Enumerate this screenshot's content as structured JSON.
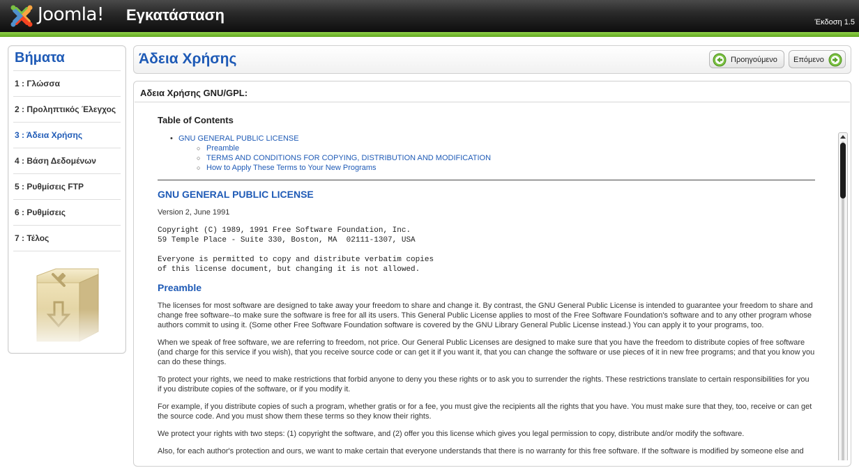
{
  "header": {
    "logo_text": "Joomla!",
    "title": "Εγκατάσταση",
    "version": "Έκδοση 1.5"
  },
  "sidebar": {
    "title": "Βήματα",
    "items": [
      {
        "label": "1 : Γλώσσα"
      },
      {
        "label": "2 : Προληπτικός Έλεγχος"
      },
      {
        "label": "3 : Άδεια Χρήσης",
        "active": true
      },
      {
        "label": "4 : Βάση Δεδομένων"
      },
      {
        "label": "5 : Ρυθμίσεις FTP"
      },
      {
        "label": "6 : Ρυθμίσεις"
      },
      {
        "label": "7 : Τέλος"
      }
    ],
    "icon": "install-box-icon"
  },
  "titlebar": {
    "title": "Άδεια Χρήσης",
    "prev_label": "Προηγούμενο",
    "next_label": "Επόμενο"
  },
  "license": {
    "heading": "Αδεια Χρήσης GNU/GPL:",
    "toc_title": "Table of Contents",
    "toc": [
      "GNU GENERAL PUBLIC LICENSE",
      "Preamble",
      "TERMS AND CONDITIONS FOR COPYING, DISTRIBUTION AND MODIFICATION",
      "How to Apply These Terms to Your New Programs"
    ],
    "gpl_title": "GNU GENERAL PUBLIC LICENSE",
    "version_line": "Version 2, June 1991",
    "copyright": "Copyright (C) 1989, 1991 Free Software Foundation, Inc.\n59 Temple Place - Suite 330, Boston, MA  02111-1307, USA",
    "permission": "Everyone is permitted to copy and distribute verbatim copies\nof this license document, but changing it is not allowed.",
    "preamble_title": "Preamble",
    "paragraphs": [
      "The licenses for most software are designed to take away your freedom to share and change it. By contrast, the GNU General Public License is intended to guarantee your freedom to share and change free software--to make sure the software is free for all its users. This General Public License applies to most of the Free Software Foundation's software and to any other program whose authors commit to using it. (Some other Free Software Foundation software is covered by the GNU Library General Public License instead.) You can apply it to your programs, too.",
      "When we speak of free software, we are referring to freedom, not price. Our General Public Licenses are designed to make sure that you have the freedom to distribute copies of free software (and charge for this service if you wish), that you receive source code or can get it if you want it, that you can change the software or use pieces of it in new free programs; and that you know you can do these things.",
      "To protect your rights, we need to make restrictions that forbid anyone to deny you these rights or to ask you to surrender the rights. These restrictions translate to certain responsibilities for you if you distribute copies of the software, or if you modify it.",
      "For example, if you distribute copies of such a program, whether gratis or for a fee, you must give the recipients all the rights that you have. You must make sure that they, too, receive or can get the source code. And you must show them these terms so they know their rights.",
      "We protect your rights with two steps: (1) copyright the software, and (2) offer you this license which gives you legal permission to copy, distribute and/or modify the software.",
      "Also, for each author's protection and ours, we want to make certain that everyone understands that there is no warranty for this free software. If the software is modified by someone else and"
    ]
  },
  "colors": {
    "accent_blue": "#1e5ab6",
    "header_green": "#6cb52b",
    "header_dark": "#1a1a1a"
  }
}
